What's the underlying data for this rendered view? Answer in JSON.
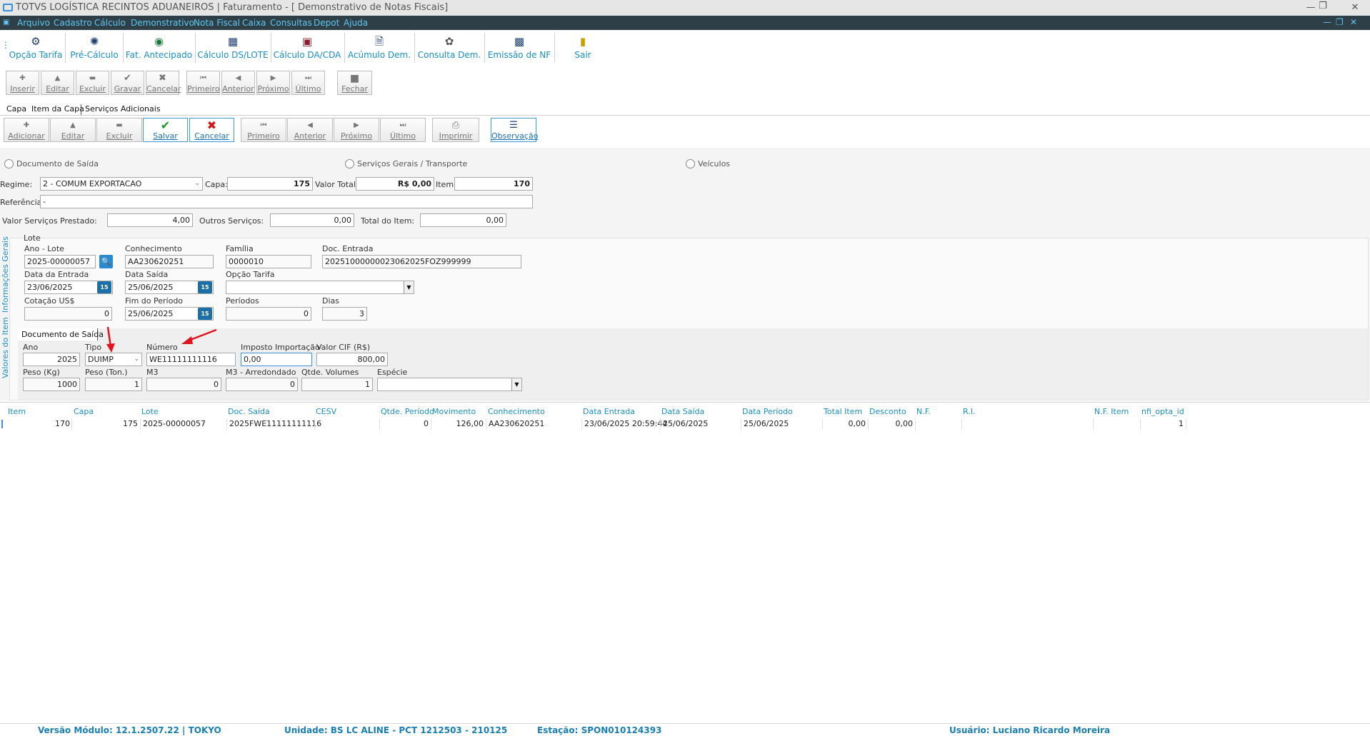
{
  "window": {
    "title": "TOTVS LOGÍSTICA RECINTOS ADUANEIROS | Faturamento - [ Demonstrativo de Notas Fiscais]"
  },
  "menu": [
    "Arquivo",
    "Cadastro",
    "Cálculo",
    "Demonstrativo",
    "Nota Fiscal",
    "Caixa",
    "Consultas",
    "Depot",
    "Ajuda"
  ],
  "toolbar": {
    "opcao_tarifa": "Opção Tarifa",
    "pre_calculo": "Pré-Cálculo",
    "fat_antecipado": "Fat. Antecipado",
    "calculo_ds_lote": "Cálculo DS/LOTE",
    "calculo_da_cda": "Cálculo DA/CDA",
    "acumulo_dem": "Acúmulo Dem.",
    "consulta_dem": "Consulta Dem.",
    "emissao_nf": "Emissão de NF",
    "sair": "Sair"
  },
  "nav1": {
    "inserir": "Inserir",
    "editar": "Editar",
    "excluir": "Excluir",
    "gravar": "Gravar",
    "cancelar": "Cancelar",
    "primeiro": "Primeiro",
    "anterior": "Anterior",
    "proximo": "Próximo",
    "ultimo": "Último",
    "fechar": "Fechar"
  },
  "tabs": {
    "capa": "Capa",
    "item_capa": "Item da Capa",
    "servicos": "Serviços Adicionais"
  },
  "nav2": {
    "adicionar": "Adicionar",
    "editar": "Editar",
    "excluir": "Excluir",
    "salvar": "Salvar",
    "cancelar": "Cancelar",
    "primeiro": "Primeiro",
    "anterior": "Anterior",
    "proximo": "Próximo",
    "ultimo": "Último",
    "imprimir": "Imprimir",
    "observacao": "Observação"
  },
  "radios": {
    "doc_saida": "Documento de Saída",
    "servicos_gerais": "Serviços Gerais / Transporte",
    "veiculos": "Veículos"
  },
  "form": {
    "regime_label": "Regime:",
    "regime_value": "2 - COMUM EXPORTACAO",
    "capa_label": "Capa:",
    "capa_value": "175",
    "valor_total_label": "Valor Total:",
    "valor_total_value": "R$ 0,00",
    "item_label": "Item:",
    "item_value": "170",
    "referencia_label": "Referência:",
    "referencia_value": "-",
    "valor_servicos_label": "Valor Serviços Prestado:",
    "valor_servicos_value": "4,00",
    "outros_servicos_label": "Outros Serviços:",
    "outros_servicos_value": "0,00",
    "total_item_label": "Total do Item:",
    "total_item_value": "0,00"
  },
  "side_tabs": {
    "info_gerais": "Informações Gerais",
    "valores_item": "Valores do Item"
  },
  "lote": {
    "title": "Lote",
    "ano_lote_label": "Ano - Lote",
    "ano_lote_value": "2025-00000057",
    "conhecimento_label": "Conhecimento",
    "conhecimento_value": "AA230620251",
    "familia_label": "Família",
    "familia_value": "0000010",
    "doc_entrada_label": "Doc. Entrada",
    "doc_entrada_value": "20251000000023062025FOZ999999",
    "data_entrada_label": "Data da Entrada",
    "data_entrada_value": "23/06/2025",
    "data_saida_label": "Data Saída",
    "data_saida_value": "25/06/2025",
    "opcao_tarifa_label": "Opção Tarifa",
    "opcao_tarifa_value": "",
    "cotacao_label": "Cotação US$",
    "cotacao_value": "0",
    "fim_periodo_label": "Fim do Período",
    "fim_periodo_value": "25/06/2025",
    "periodos_label": "Períodos",
    "periodos_value": "0",
    "dias_label": "Dias",
    "dias_value": "3",
    "cal_icon": "15"
  },
  "doc_saida": {
    "title": "Documento de Saída",
    "ano_label": "Ano",
    "ano_value": "2025",
    "tipo_label": "Tipo",
    "tipo_value": "DUIMP",
    "numero_label": "Número",
    "numero_value": "WE11111111116",
    "imposto_label": "Imposto Importação",
    "imposto_value": "0,00",
    "valor_cif_label": "Valor CIF (R$)",
    "valor_cif_value": "800,00",
    "peso_kg_label": "Peso (Kg)",
    "peso_kg_value": "1000",
    "peso_ton_label": "Peso (Ton.)",
    "peso_ton_value": "1",
    "m3_label": "M3",
    "m3_value": "0",
    "m3_arred_label": "M3 - Arredondado",
    "m3_arred_value": "0",
    "qtde_volumes_label": "Qtde. Volumes",
    "qtde_volumes_value": "1",
    "especie_label": "Espécie",
    "especie_value": ""
  },
  "grid": {
    "headers": [
      "Item",
      "Capa",
      "Lote",
      "Doc. Saída",
      "CESV",
      "Qtde. Período",
      "Movimento",
      "Conhecimento",
      "Data Entrada",
      "Data Saída",
      "Data Período",
      "Total Item",
      "Desconto",
      "N.F.",
      "R.I.",
      "N.F. Item",
      "nfi_opta_id"
    ],
    "row": [
      "170",
      "175",
      "2025-00000057",
      "2025FWE11111111116",
      "",
      "0",
      "126,00",
      "AA230620251",
      "23/06/2025 20:59:44",
      "25/06/2025",
      "25/06/2025",
      "0,00",
      "0,00",
      "",
      "",
      "",
      "1"
    ]
  },
  "status": {
    "versao": "Versão Módulo:  12.1.2507.22  |  TOKYO",
    "unidade": "Unidade: BS LC ALINE - PCT 1212503 - 210125",
    "estacao": "Estação: SPON010124393",
    "usuario": "Usuário: Luciano Ricardo Moreira"
  }
}
